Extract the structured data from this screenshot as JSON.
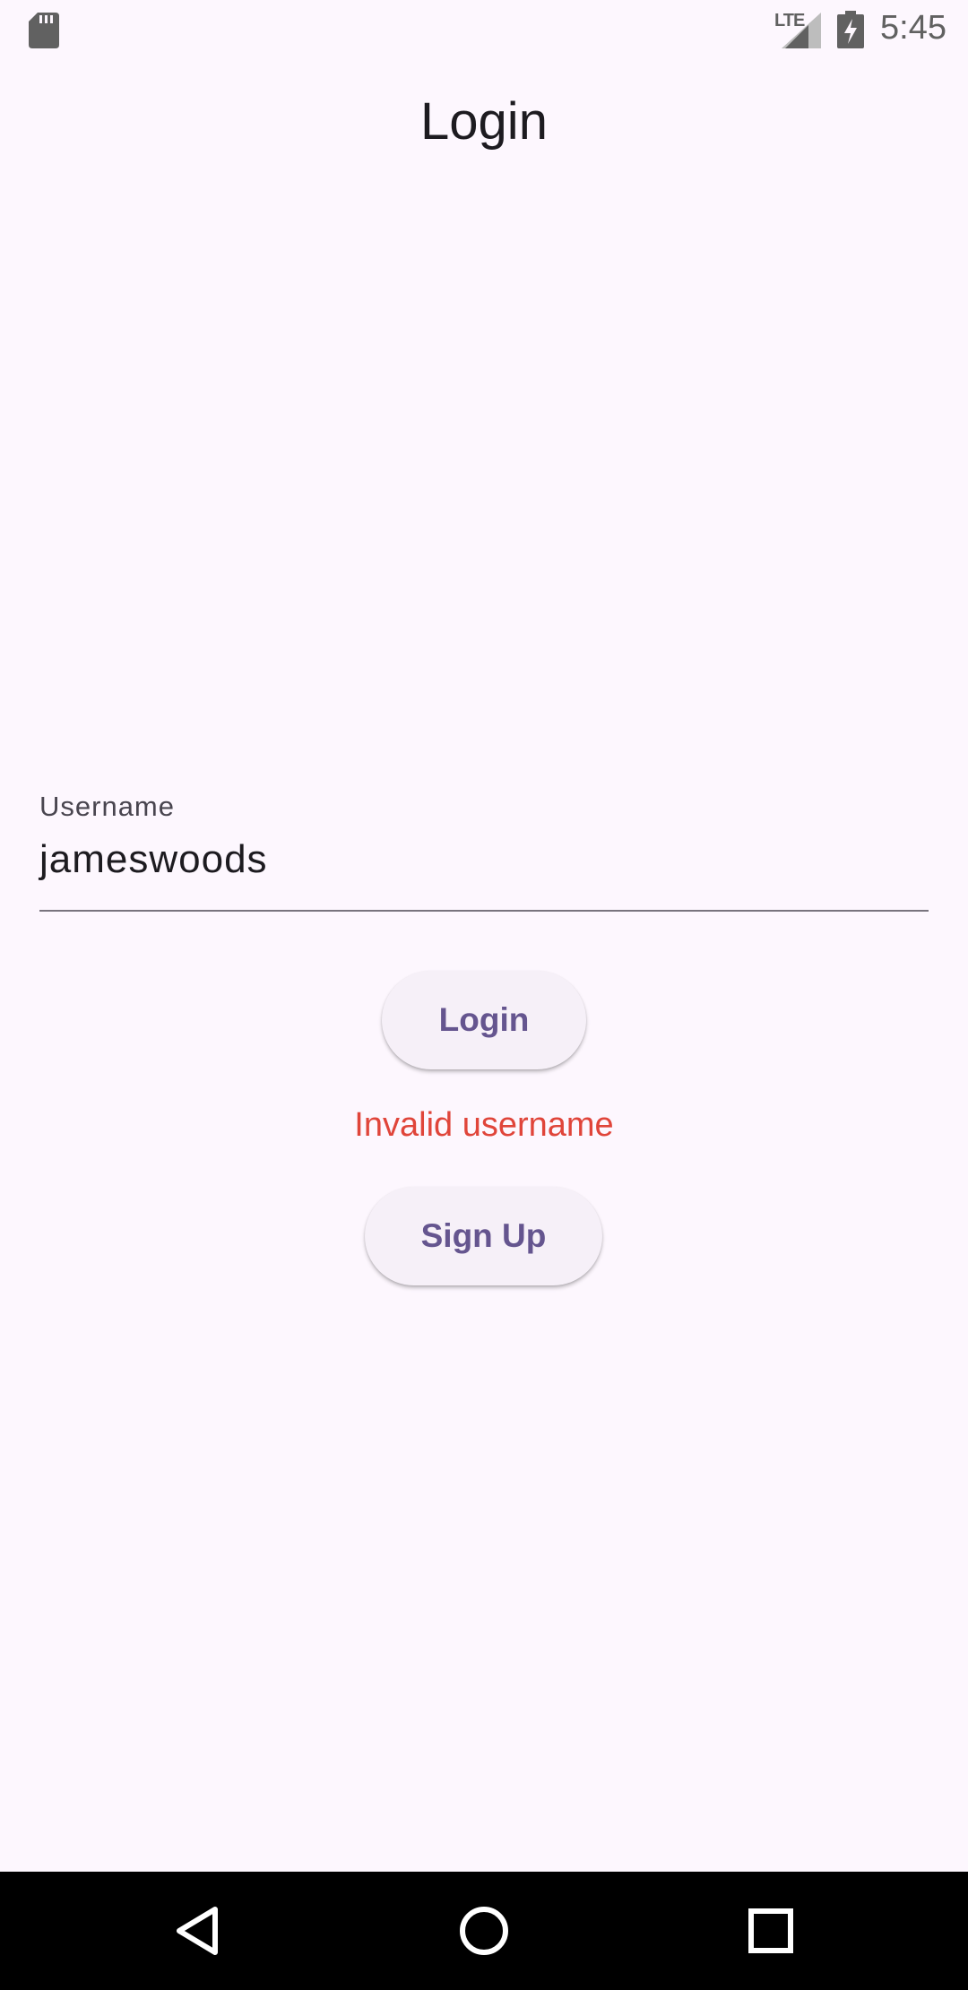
{
  "status_bar": {
    "network": "LTE",
    "time": "5:45",
    "icons": [
      "sd-card-icon",
      "signal-icon",
      "battery-charging-icon"
    ]
  },
  "app_bar": {
    "title": "Login"
  },
  "form": {
    "username_label": "Username",
    "username_value": "jameswoods"
  },
  "actions": {
    "login_label": "Login",
    "error_message": "Invalid username",
    "signup_label": "Sign Up"
  },
  "nav_bar": {
    "icons": [
      "back-icon",
      "home-icon",
      "recents-icon"
    ]
  },
  "colors": {
    "background": "#FDF7FE",
    "button_text": "#65558F",
    "button_fill": "#F6F0F8",
    "error": "#E0453A",
    "title_text": "#1D1B20",
    "underline": "#79747E"
  }
}
